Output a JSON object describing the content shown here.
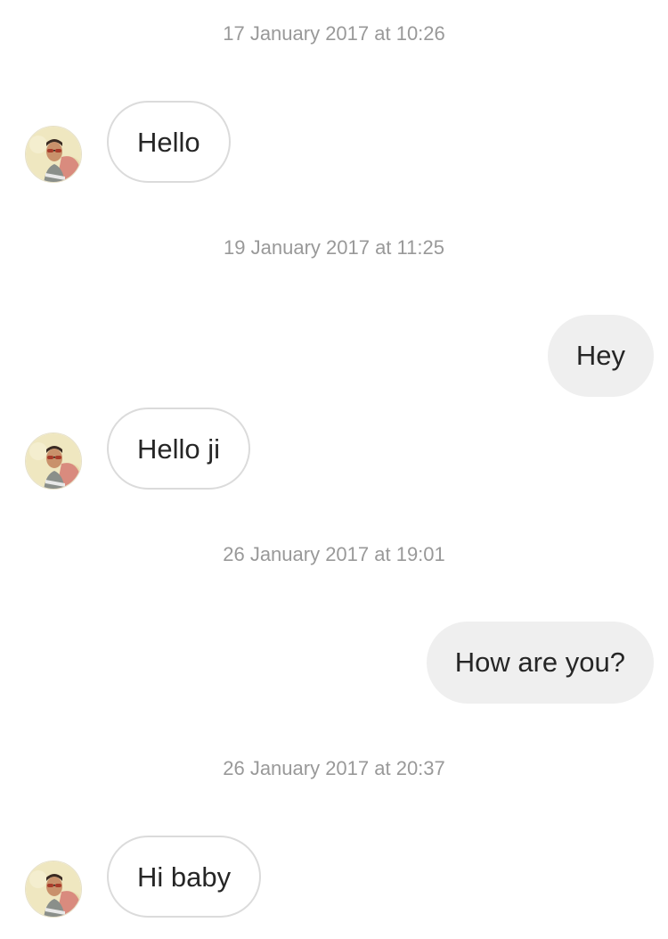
{
  "thread": {
    "messages": [
      {
        "timestamp": "17 January 2017 at 10:26",
        "text": "Hello",
        "direction": "incoming"
      },
      {
        "timestamp": "19 January 2017 at 11:25",
        "text": "Hey",
        "direction": "outgoing"
      },
      {
        "text": "Hello ji",
        "direction": "incoming"
      },
      {
        "timestamp": "26 January 2017 at 19:01",
        "text": "How are you?",
        "direction": "outgoing"
      },
      {
        "timestamp": "26 January 2017 at 20:37",
        "text": "Hi baby",
        "direction": "incoming"
      }
    ]
  },
  "colors": {
    "incoming_border": "#dbdbdb",
    "outgoing_fill": "#efefef",
    "timestamp_text": "#999999",
    "message_text": "#262626"
  },
  "icons": {
    "sender_avatar": "avatar-photo"
  }
}
